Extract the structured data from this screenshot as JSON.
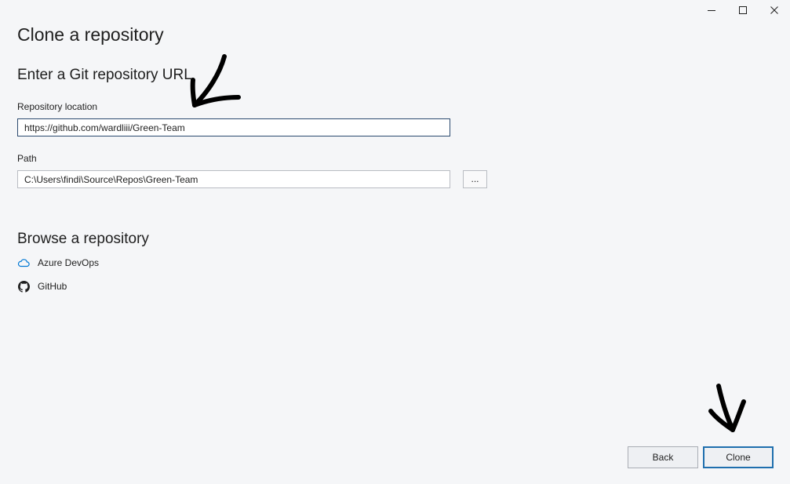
{
  "window": {
    "title": "Clone a repository",
    "controls": {
      "minimize_icon": "minimize-icon",
      "maximize_icon": "maximize-icon",
      "close_icon": "close-icon"
    }
  },
  "git_url_section": {
    "title": "Enter a Git repository URL",
    "repository_location": {
      "label": "Repository location",
      "value": "https://github.com/wardliii/Green-Team"
    },
    "path": {
      "label": "Path",
      "value": "C:\\Users\\findi\\Source\\Repos\\Green-Team",
      "browse_label": "..."
    }
  },
  "browse_section": {
    "title": "Browse a repository",
    "items": [
      {
        "label": "Azure DevOps",
        "icon": "azure-devops-cloud-icon"
      },
      {
        "label": "GitHub",
        "icon": "github-icon"
      }
    ]
  },
  "footer": {
    "back_label": "Back",
    "clone_label": "Clone"
  },
  "colors": {
    "background": "#f5f6f8",
    "focused_border": "#2b4a6f",
    "default_border": "#b9bcc2",
    "clone_button_border": "#1f6fae",
    "azure_icon": "#0078d4",
    "annotation_ink": "#000000"
  }
}
